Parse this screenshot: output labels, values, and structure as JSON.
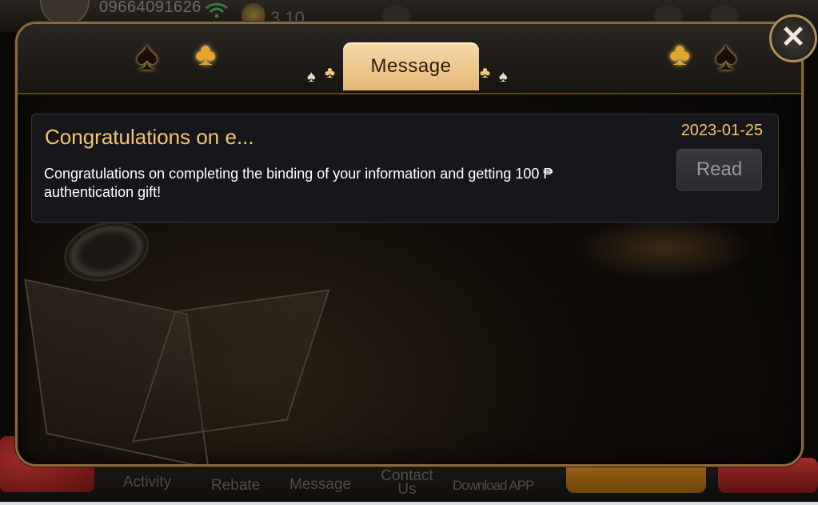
{
  "background": {
    "phone": "09664091626",
    "coin_value": "3.10",
    "bottom_nav": [
      {
        "label": "Activity"
      },
      {
        "label": "Rebate"
      },
      {
        "label": "Message"
      },
      {
        "label": "Contact Us"
      },
      {
        "label": "Download APP"
      }
    ]
  },
  "dialog": {
    "title": "Message",
    "close_icon": "close-icon"
  },
  "messages": [
    {
      "title": "Congratulations on e...",
      "date": "2023-01-25",
      "body": "Congratulations on completing the binding of your information and getting 100 ₱ authentication gift!",
      "action_label": "Read"
    }
  ],
  "colors": {
    "accent_gold": "#f4c470",
    "tab_bg": "#f0cf98",
    "border": "#8a6a3a"
  }
}
